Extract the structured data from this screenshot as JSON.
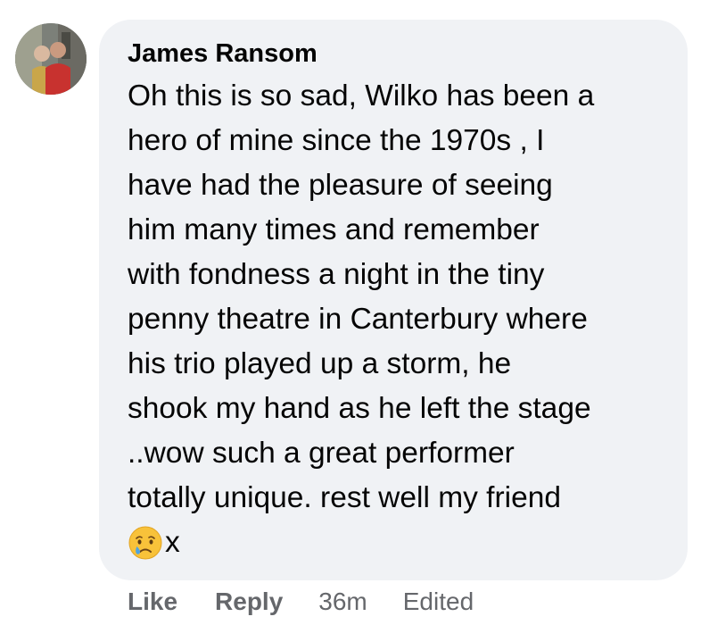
{
  "comment": {
    "author": "James Ransom",
    "lines": [
      "Oh this is so sad, Wilko has been a",
      "hero of mine since the 1970s , I",
      "have had the pleasure of seeing",
      "him many times and remember",
      "with fondness a night in the tiny",
      "penny theatre in Canterbury where",
      "his trio played up a storm, he",
      "shook my hand as he left the stage",
      "..wow such a great performer",
      "totally unique. rest well my friend"
    ],
    "end_emoji": "crying-face-emoji",
    "end_suffix": "x"
  },
  "actions": {
    "like": "Like",
    "reply": "Reply",
    "time": "36m",
    "edited": "Edited"
  },
  "colors": {
    "bubble": "#f0f2f5",
    "text": "#050505",
    "meta": "#65676b"
  }
}
